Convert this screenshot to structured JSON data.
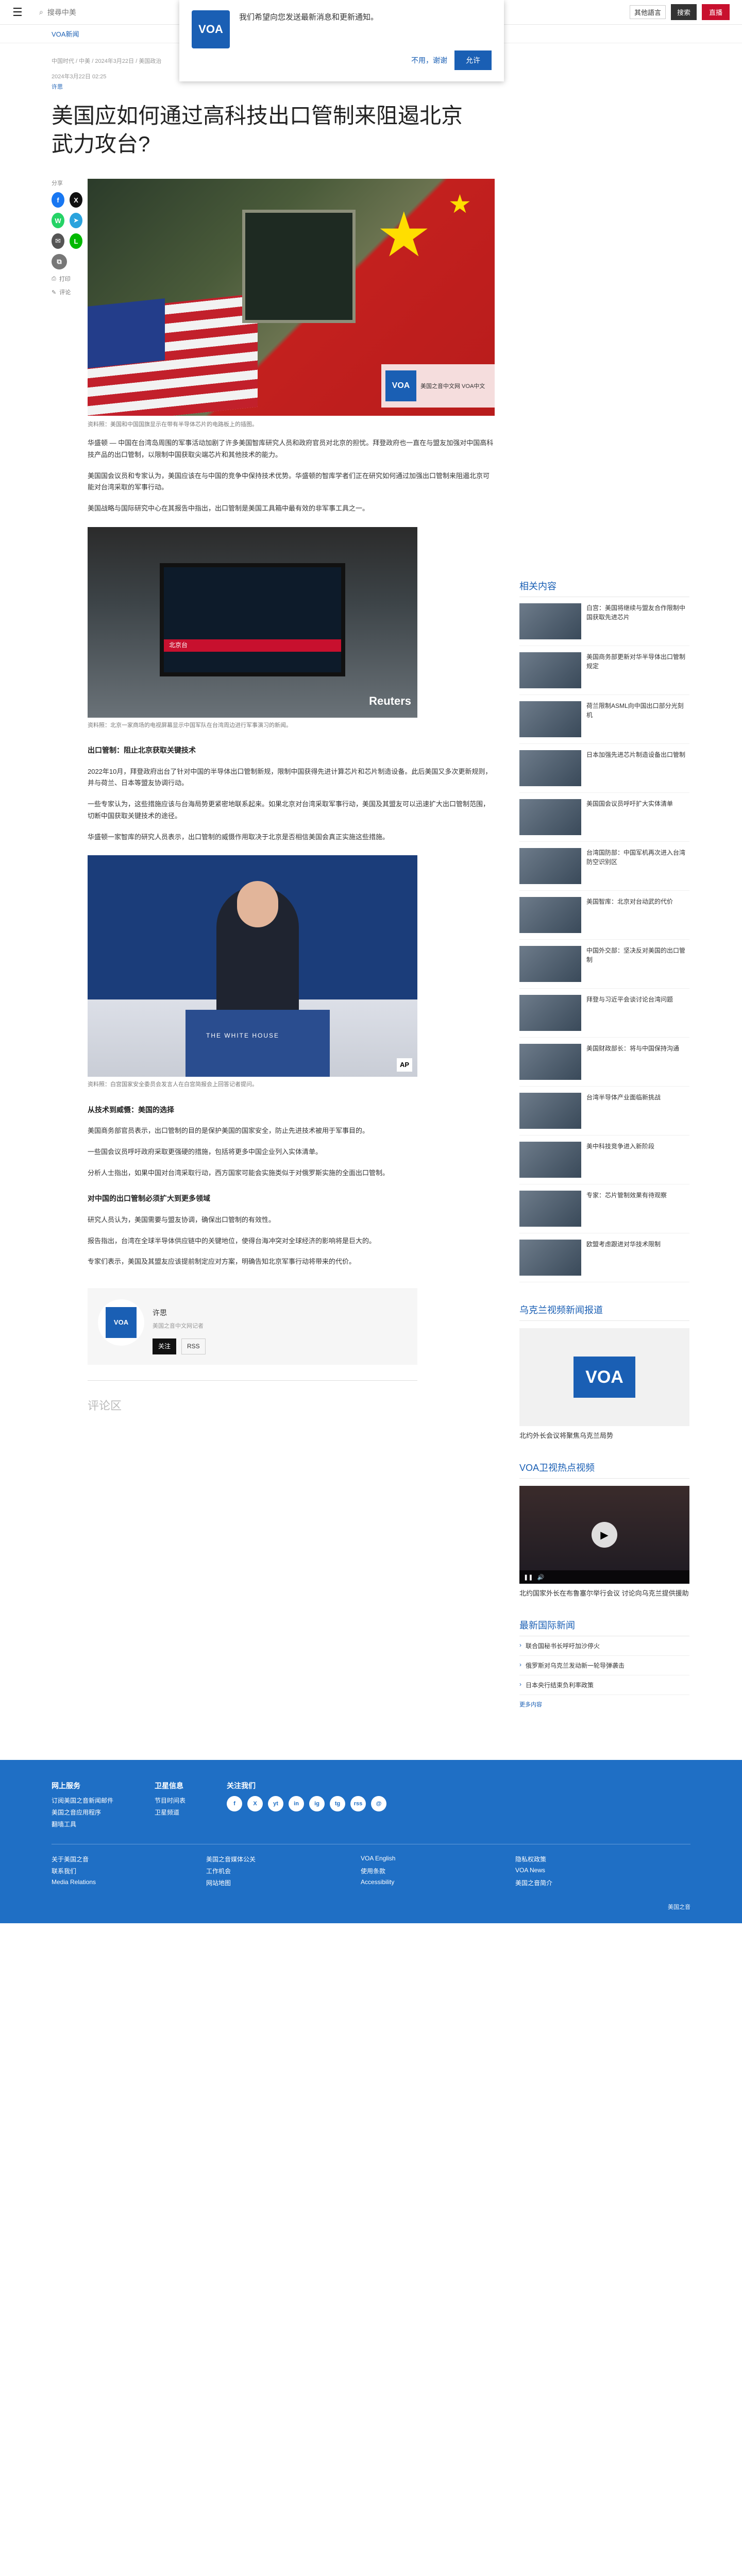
{
  "topbar": {
    "search_placeholder": "搜尋中美",
    "lang_label": "其他語言",
    "live_label": "直播",
    "search_label": "搜索"
  },
  "popup": {
    "logo": "VOA",
    "text": "我们希望向您发送最新消息和更新通知。",
    "no_label": "不用，谢谢",
    "yes_label": "允许"
  },
  "subnav": {
    "label": "VOA新闻"
  },
  "article": {
    "crumbs": "中国时代 / 中美 / 2024年3月22日 / 美国政治",
    "date": "2024年3月22日 02:25",
    "author": "许思",
    "title": "美国应如何通过高科技出口管制来阻遏北京武力攻台?",
    "share_label": "分享",
    "print_label": "打印",
    "comment_label": "评论",
    "hero_watermark_logo": "VOA",
    "hero_watermark_text": "美国之音中文网 VOA中文",
    "hero_caption": "资料照：美国和中国国旗显示在带有半导体芯片的电路板上的插图。",
    "paragraphs": [
      "华盛顿 — 中国在台湾岛周围的军事活动加剧了许多美国智库研究人员和政府官员对北京的担忧。拜登政府也一直在与盟友加强对中国高科技产品的出口管制，以限制中国获取尖端芯片和其他技术的能力。",
      "美国国会议员和专家认为，美国应该在与中国的竞争中保持技术优势。华盛顿的智库学者们正在研究如何通过加强出口管制来阻遏北京可能对台湾采取的军事行动。",
      "美国战略与国际研究中心在其报告中指出，出口管制是美国工具箱中最有效的非军事工具之一。"
    ],
    "fig1_band": "北京台",
    "fig1_credit": "Reuters",
    "fig1_caption": "资料照：北京一家商场的电视屏幕显示中国军队在台湾周边进行军事演习的新闻。",
    "h_section1": "出口管制：阻止北京获取关键技术",
    "paragraphs2": [
      "2022年10月，拜登政府出台了针对中国的半导体出口管制新规，限制中国获得先进计算芯片和芯片制造设备。此后美国又多次更新规则，并与荷兰、日本等盟友协调行动。",
      "一些专家认为，这些措施应该与台海局势更紧密地联系起来。如果北京对台湾采取军事行动，美国及其盟友可以迅速扩大出口管制范围，切断中国获取关键技术的途径。",
      "华盛顿一家智库的研究人员表示，出口管制的威慑作用取决于北京是否相信美国会真正实施这些措施。"
    ],
    "fig2_wall": "THE WHITE HOUSE",
    "fig2_credit": "AP",
    "fig2_caption": "资料照：白宫国家安全委员会发言人在白宫简报会上回答记者提问。",
    "h_section2": "从技术到威慑：美国的选择",
    "paragraphs3": [
      "美国商务部官员表示，出口管制的目的是保护美国的国家安全，防止先进技术被用于军事目的。",
      "一些国会议员呼吁政府采取更强硬的措施，包括将更多中国企业列入实体清单。",
      "分析人士指出，如果中国对台湾采取行动，西方国家可能会实施类似于对俄罗斯实施的全面出口管制。"
    ],
    "h_section3": "对中国的出口管制必须扩大到更多领域",
    "paragraphs4": [
      "研究人员认为，美国需要与盟友协调，确保出口管制的有效性。",
      "报告指出，台湾在全球半导体供应链中的关键地位，使得台海冲突对全球经济的影响将是巨大的。",
      "专家们表示，美国及其盟友应该提前制定应对方案，明确告知北京军事行动将带来的代价。"
    ],
    "author_box": {
      "logo": "VOA",
      "name": "许思",
      "role": "美国之音中文网记者",
      "follow_tw": "关注",
      "rss": "RSS"
    },
    "comments_label": "评论区"
  },
  "sidebar": {
    "related_heading": "相关内容",
    "related": [
      "白宫：美国将继续与盟友合作限制中国获取先进芯片",
      "美国商务部更新对华半导体出口管制规定",
      "荷兰限制ASML向中国出口部分光刻机",
      "日本加强先进芯片制造设备出口管制",
      "美国国会议员呼吁扩大实体清单",
      "台湾国防部：中国军机再次进入台湾防空识别区",
      "美国智库：北京对台动武的代价",
      "中国外交部：坚决反对美国的出口管制",
      "拜登与习近平会谈讨论台湾问题",
      "美国财政部长：将与中国保持沟通",
      "台湾半导体产业面临新挑战",
      "美中科技竞争进入新阶段",
      "专家：芯片管制效果有待观察",
      "欧盟考虑跟进对华技术限制"
    ],
    "voices_heading": "乌克兰视频新闻报道",
    "voices_logo": "VOA",
    "voices_title": "北约外长会议将聚焦乌克兰局势",
    "video_heading": "VOA卫视热点视频",
    "video_title": "北约国家外长在布鲁塞尔举行会议 讨论向乌克兰提供援助",
    "world_heading": "最新国际新闻",
    "world": [
      "联合国秘书长呼吁加沙停火",
      "俄罗斯对乌克兰发动新一轮导弹袭击",
      "日本央行结束负利率政策"
    ],
    "more_label": "更多内容"
  },
  "footer": {
    "col1_title": "网上服务",
    "col1": [
      "订阅美国之音新闻邮件",
      "美国之音应用程序",
      "翻墙工具"
    ],
    "col2_title": "卫星信息",
    "col2": [
      "节目时间表",
      "卫星频道"
    ],
    "col3_title": "关注我们",
    "social": [
      "f",
      "X",
      "yt",
      "in",
      "ig",
      "tg",
      "rss",
      "@"
    ],
    "grid": [
      "关于美国之音",
      "美国之音媒体公关",
      "VOA English",
      "隐私权政策",
      "联系我们",
      "工作机会",
      "使用条款",
      "VOA News",
      "Media Relations",
      "网站地图",
      "Accessibility",
      "美国之音简介"
    ],
    "copy": "美国之音"
  }
}
